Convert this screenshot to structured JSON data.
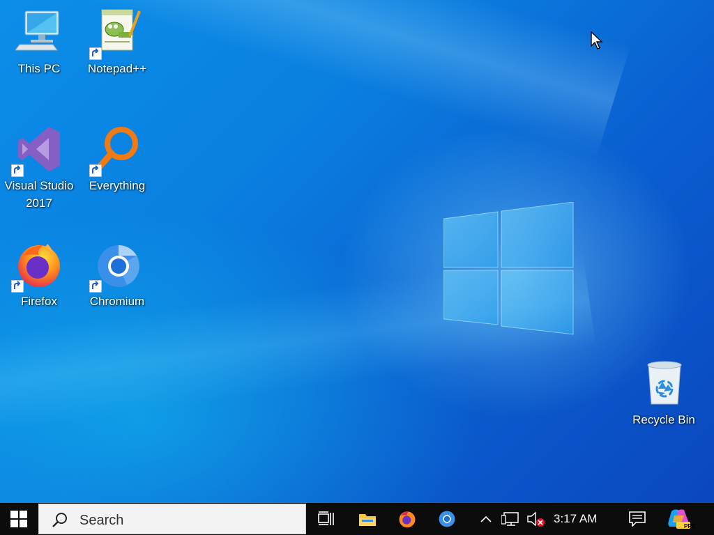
{
  "desktop": {
    "icons": [
      {
        "label": "This PC",
        "icon": "computer-icon"
      },
      {
        "label": "Notepad++",
        "icon": "notepad-plus-plus-icon"
      },
      {
        "label": "Visual Studio 2017",
        "icon": "visual-studio-icon"
      },
      {
        "label": "Everything",
        "icon": "everything-search-icon"
      },
      {
        "label": "Firefox",
        "icon": "firefox-icon"
      },
      {
        "label": "Chromium",
        "icon": "chromium-icon"
      },
      {
        "label": "Recycle Bin",
        "icon": "recycle-bin-icon"
      }
    ]
  },
  "taskbar": {
    "start": {
      "icon": "windows-start-icon"
    },
    "search": {
      "placeholder": "Search",
      "icon": "search-icon"
    },
    "task_view": {
      "icon": "task-view-icon"
    },
    "pinned": [
      {
        "name": "File Explorer",
        "icon": "file-explorer-icon"
      },
      {
        "name": "Firefox",
        "icon": "firefox-icon"
      },
      {
        "name": "Chromium",
        "icon": "chromium-icon"
      }
    ],
    "tray": {
      "chevron": "chevron-up-icon",
      "network": "network-icon",
      "volume": "volume-muted-icon",
      "time": "3:17 AM",
      "notifications": "action-center-icon",
      "copilot": {
        "icon": "copilot-icon",
        "badge": "PRE"
      }
    }
  },
  "colors": {
    "accent": "#0a7fe0",
    "taskbar": "#0c0c0c"
  }
}
